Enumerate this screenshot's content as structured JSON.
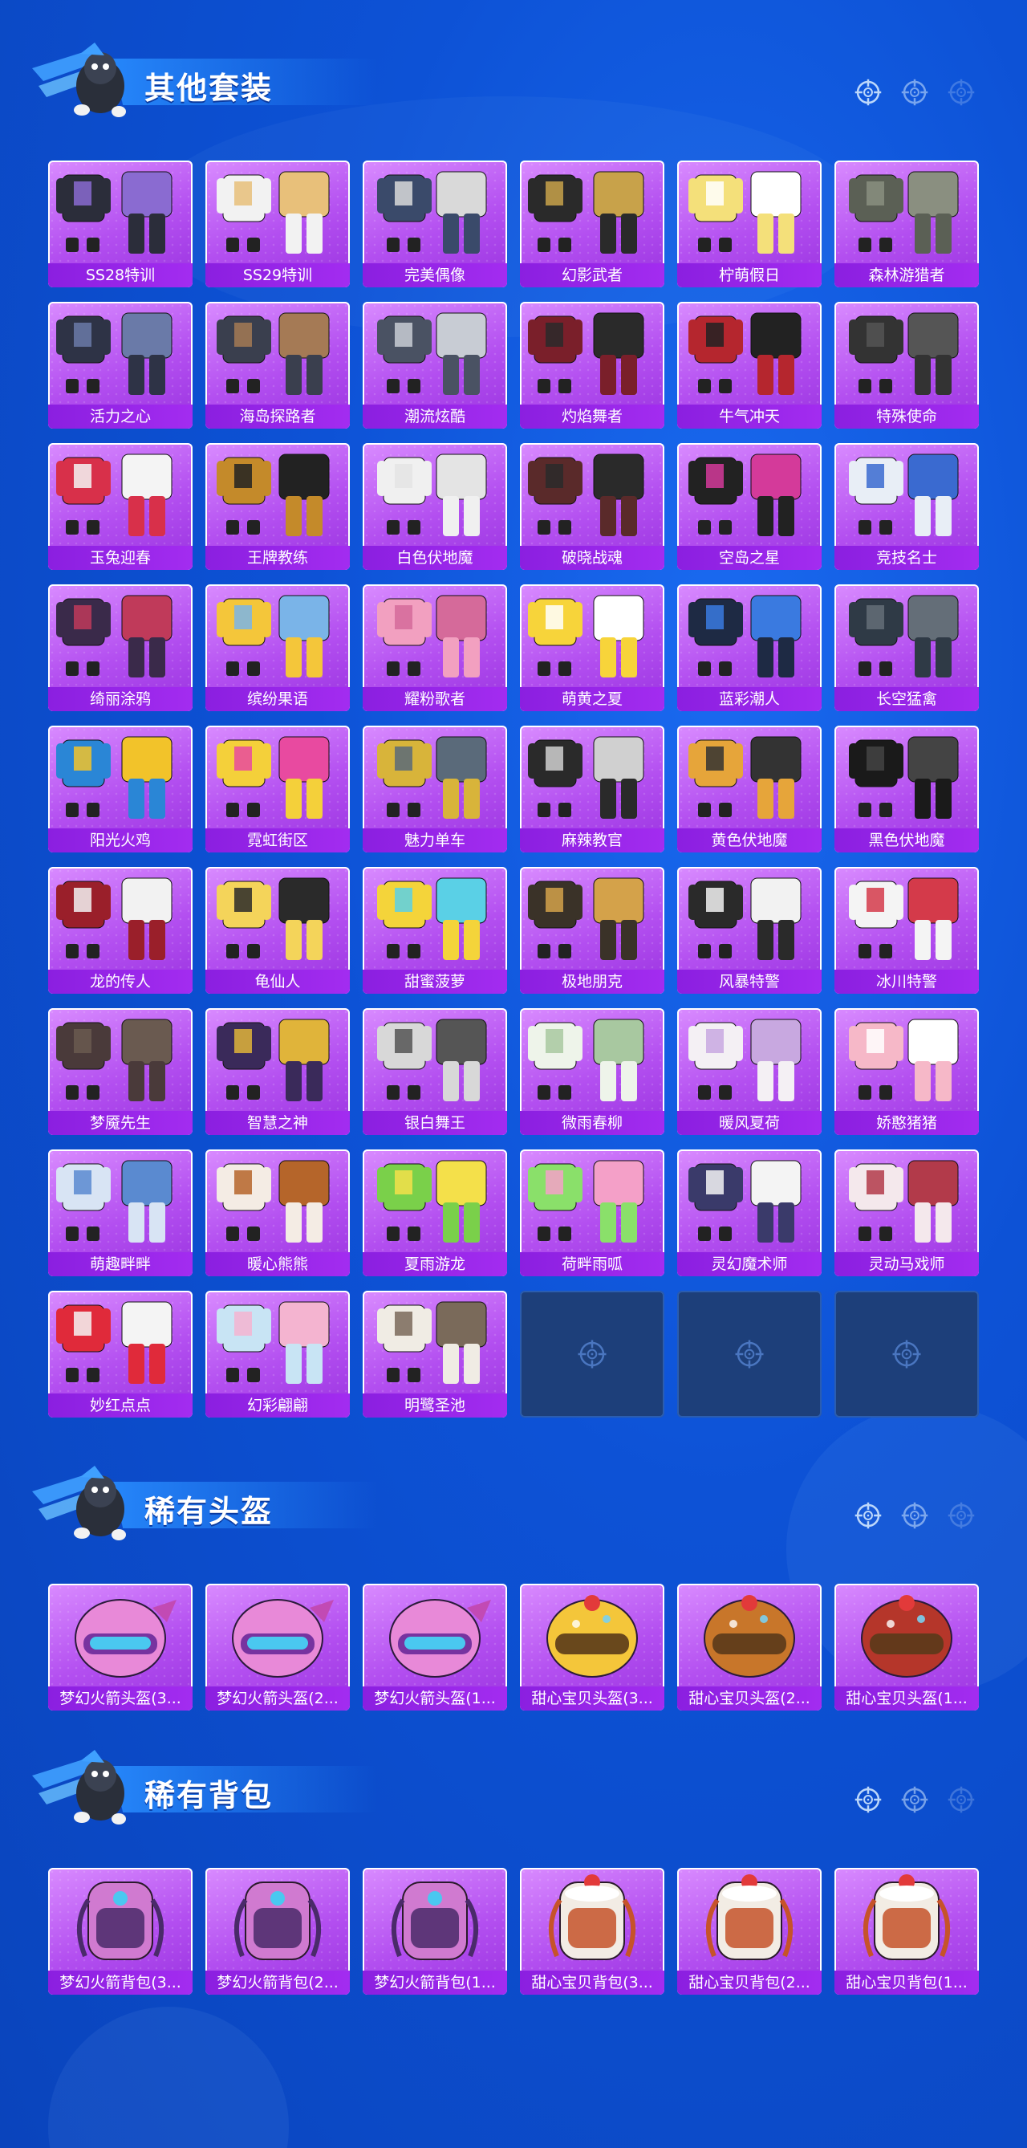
{
  "colors": {
    "background": "#0b4fd0",
    "card_purple": "#b34ff0",
    "label_purple": "#9a2be8",
    "empty_slot": "#1d3f7a"
  },
  "sections": [
    {
      "title": "其他套装",
      "items": [
        "SS28特训",
        "SS29特训",
        "完美偶像",
        "幻影武者",
        "柠萌假日",
        "森林游猎者",
        "活力之心",
        "海岛探路者",
        "潮流炫酷",
        "灼焰舞者",
        "牛气冲天",
        "特殊使命",
        "玉兔迎春",
        "王牌教练",
        "白色伏地魔",
        "破晓战魂",
        "空岛之星",
        "竞技名士",
        "绮丽涂鸦",
        "缤纷果语",
        "耀粉歌者",
        "萌黄之夏",
        "蓝彩潮人",
        "长空猛禽",
        "阳光火鸡",
        "霓虹街区",
        "魅力单车",
        "麻辣教官",
        "黄色伏地魔",
        "黑色伏地魔",
        "龙的传人",
        "龟仙人",
        "甜蜜菠萝",
        "极地朋克",
        "风暴特警",
        "冰川特警",
        "梦魇先生",
        "智慧之神",
        "银白舞王",
        "微雨春柳",
        "暖风夏荷",
        "娇憨猪猪",
        "萌趣畔畔",
        "暖心熊熊",
        "夏雨游龙",
        "荷畔雨呱",
        "灵幻魔术师",
        "灵动马戏师",
        "妙红点点",
        "幻彩翩翩",
        "明鹭圣池"
      ],
      "empty_slots": 3
    },
    {
      "title": "稀有头盔",
      "items": [
        "梦幻火箭头盔(3...",
        "梦幻火箭头盔(2...",
        "梦幻火箭头盔(1...",
        "甜心宝贝头盔(3...",
        "甜心宝贝头盔(2...",
        "甜心宝贝头盔(1..."
      ],
      "empty_slots": 0
    },
    {
      "title": "稀有背包",
      "items": [
        "梦幻火箭背包(3...",
        "梦幻火箭背包(2...",
        "梦幻火箭背包(1...",
        "甜心宝贝背包(3...",
        "甜心宝贝背包(2...",
        "甜心宝贝背包(1..."
      ],
      "empty_slots": 0
    }
  ]
}
